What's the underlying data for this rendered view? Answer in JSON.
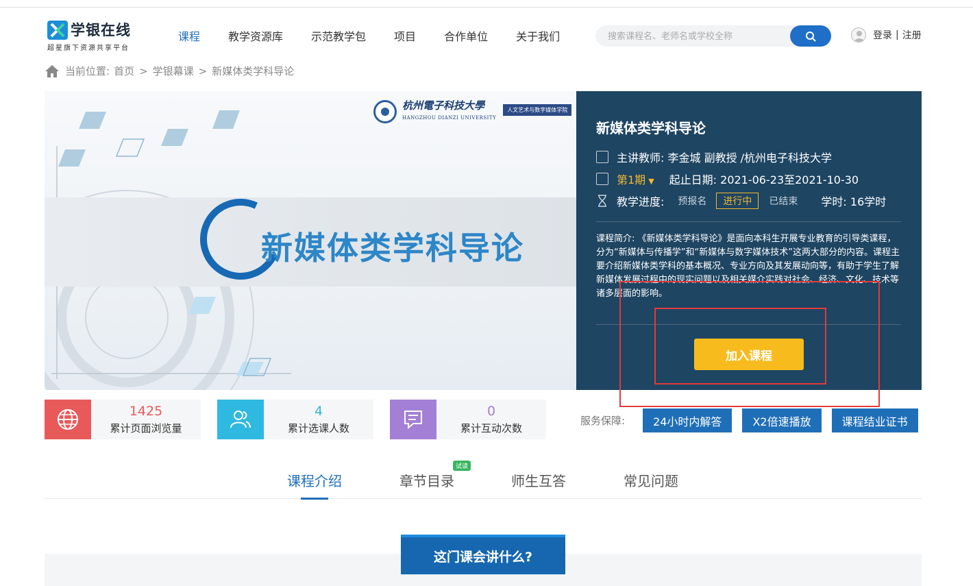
{
  "header": {
    "logo_text": "学银在线",
    "logo_sub": "超星旗下资源共享平台",
    "nav": [
      "课程",
      "教学资源库",
      "示范教学包",
      "项目",
      "合作单位",
      "关于我们"
    ],
    "search_placeholder": "搜索课程名、老师名或学校全称",
    "login": "登录",
    "sep": "|",
    "register": "注册"
  },
  "breadcrumb": {
    "prefix": "当前位置:",
    "items": [
      "首页",
      "学银幕课",
      "新媒体类学科导论"
    ],
    "arrow": ">"
  },
  "banner": {
    "title": "新媒体类学科导论",
    "university_cn": "杭州電子科技大學",
    "university_en": "HANGZHOU DIANZI UNIVERSITY",
    "college": "人文艺术与数字媒体学院"
  },
  "course": {
    "title": "新媒体类学科导论",
    "teacher": "主讲教师: 李金城 副教授 /杭州电子科技大学",
    "period": "第1期",
    "dates": "起止日期: 2021-06-23至2021-10-30",
    "progress_label": "教学进度:",
    "progress_states": [
      "预报名",
      "进行中",
      "已结束"
    ],
    "hours": "学时: 16学时",
    "intro": "课程简介:  《新媒体类学科导论》是面向本科生开展专业教育的引导类课程，分为“新媒体与传播学”和“新媒体与数字媒体技术”这两大部分的内容。课程主要介绍新媒体类学科的基本概况、专业方向及其发展动向等，有助于学生了解新媒体发展过程中的现实问题以及相关媒介实践对社会、经济、文化、技术等诸多层面的影响。",
    "join_button": "加入课程"
  },
  "stats": [
    {
      "value": "1425",
      "label": "累计页面浏览量",
      "color": "#e85a5a"
    },
    {
      "value": "4",
      "label": "累计选课人数",
      "color": "#2fb8e0"
    },
    {
      "value": "0",
      "label": "累计互动次数",
      "color": "#a37fd6"
    }
  ],
  "guarantee": {
    "label": "服务保障:",
    "items": [
      "24小时内解答",
      "X2倍速播放",
      "课程结业证书"
    ]
  },
  "tabs": {
    "items": [
      "课程介绍",
      "章节目录",
      "师生互答",
      "常见问题"
    ],
    "badge": "试读"
  },
  "section_title": "这门课会讲什么?"
}
